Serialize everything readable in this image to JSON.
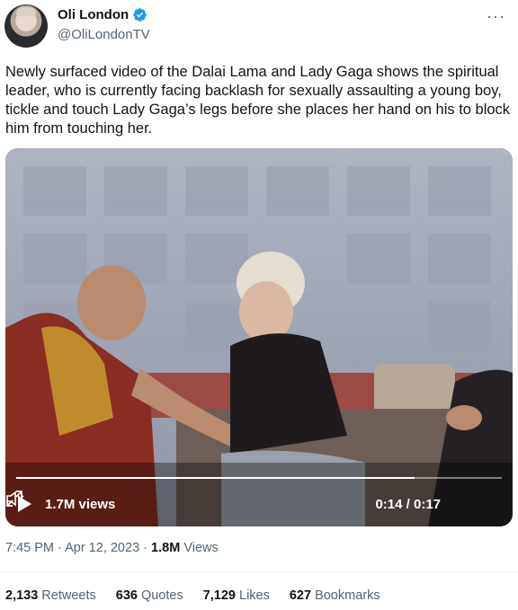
{
  "author": {
    "display_name": "Oli London",
    "handle": "@OliLondonTV",
    "verified_icon": "verified-badge-icon",
    "more_icon": "more-options-icon"
  },
  "tweet": {
    "text": "Newly surfaced video of the Dalai Lama and Lady Gaga shows the spiritual leader, who is currently facing backlash for sexually assaulting a young boy, tickle and touch Lady Gaga’s legs before she places her hand on his to block him from touching her."
  },
  "video": {
    "views_label": "1.7M views",
    "time_label": "0:14 / 0:17",
    "progress": 0.82,
    "play_icon": "play-icon",
    "mute_icon": "muted-speaker-icon",
    "fullscreen_icon": "fullscreen-icon"
  },
  "meta": {
    "time": "7:45 PM",
    "separator": " · ",
    "date": "Apr 12, 2023",
    "views_count": "1.8M",
    "views_label": "Views"
  },
  "stats": [
    {
      "count": "2,133",
      "label": "Retweets"
    },
    {
      "count": "636",
      "label": "Quotes"
    },
    {
      "count": "7,129",
      "label": "Likes"
    },
    {
      "count": "627",
      "label": "Bookmarks"
    }
  ],
  "colors": {
    "verified": "#1d9bf0",
    "secondary_text": "#536471",
    "primary_text": "#0f1419"
  }
}
